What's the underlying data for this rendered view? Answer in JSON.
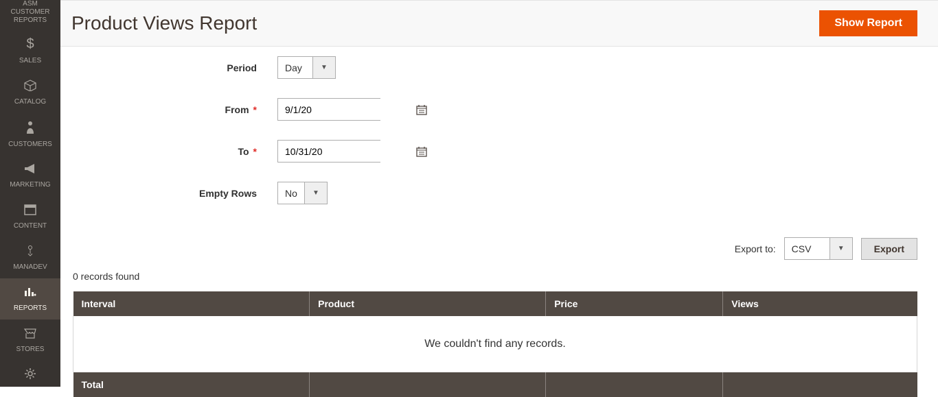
{
  "sidebar": {
    "items": [
      {
        "label": "ASM CUSTOMER REPORTS",
        "icon": ""
      },
      {
        "label": "SALES",
        "icon": "dollar"
      },
      {
        "label": "CATALOG",
        "icon": "box"
      },
      {
        "label": "CUSTOMERS",
        "icon": "person"
      },
      {
        "label": "MARKETING",
        "icon": "megaphone"
      },
      {
        "label": "CONTENT",
        "icon": "layout"
      },
      {
        "label": "MANADEV",
        "icon": "mana"
      },
      {
        "label": "REPORTS",
        "icon": "chart"
      },
      {
        "label": "STORES",
        "icon": "store"
      },
      {
        "label": "",
        "icon": "gear"
      }
    ]
  },
  "header": {
    "title": "Product Views Report",
    "show_report": "Show Report"
  },
  "filters": {
    "period": {
      "label": "Period",
      "value": "Day"
    },
    "from": {
      "label": "From",
      "value": "9/1/20"
    },
    "to": {
      "label": "To",
      "value": "10/31/20"
    },
    "empty_rows": {
      "label": "Empty Rows",
      "value": "No"
    }
  },
  "export": {
    "label": "Export to:",
    "value": "CSV",
    "button": "Export"
  },
  "records_found": "0 records found",
  "table": {
    "columns": {
      "interval": "Interval",
      "product": "Product",
      "price": "Price",
      "views": "Views"
    },
    "empty_message": "We couldn't find any records.",
    "footer": {
      "total": "Total"
    }
  }
}
